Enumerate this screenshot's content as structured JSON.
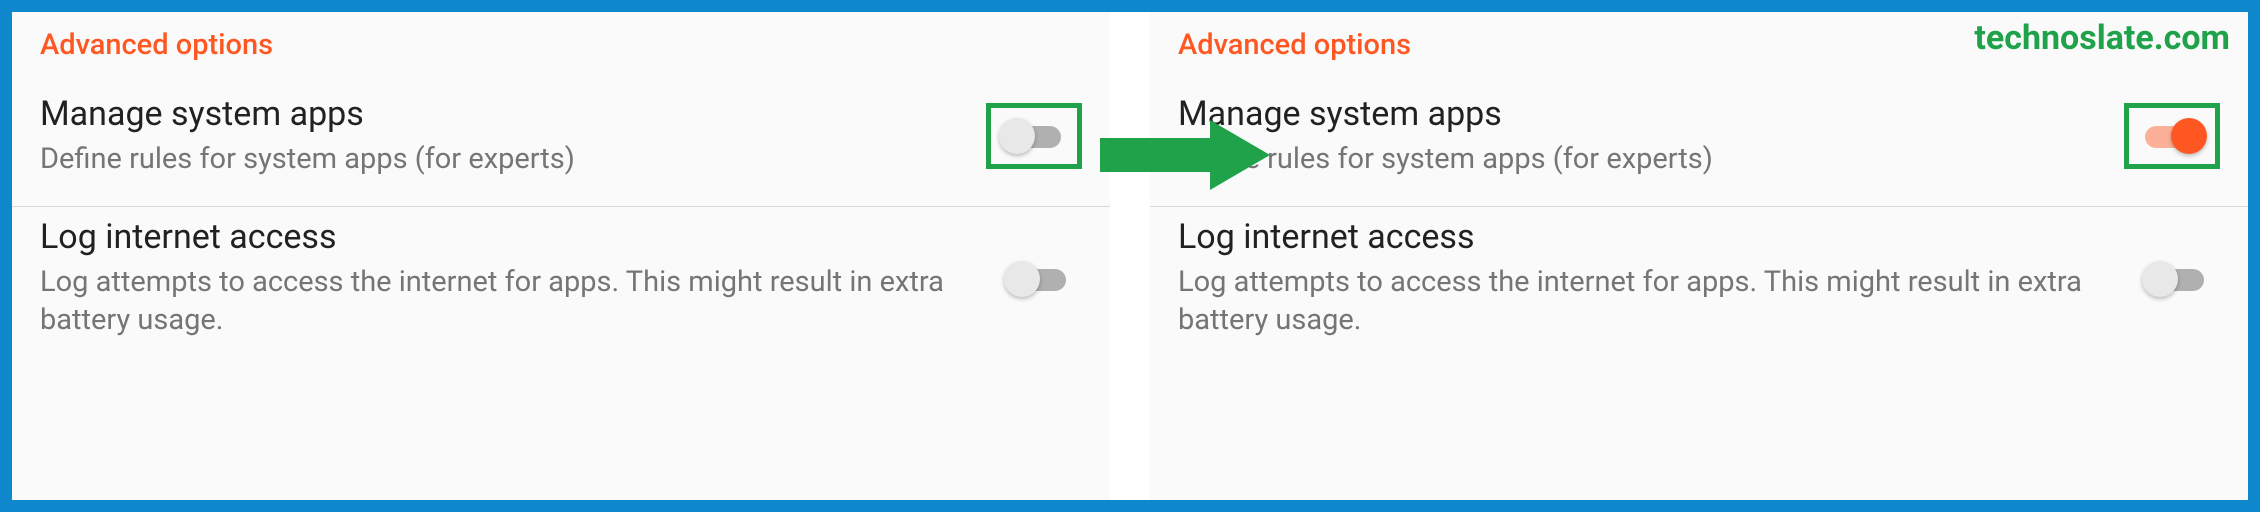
{
  "watermark": "technoslate.com",
  "panels": {
    "left": {
      "header": "Advanced options",
      "rows": [
        {
          "title": "Manage system apps",
          "subtitle": "Define rules for system apps (for experts)",
          "toggle": "off",
          "highlighted": true
        },
        {
          "title": "Log internet access",
          "subtitle": "Log attempts to access the internet for apps. This might result in extra battery usage.",
          "toggle": "off",
          "highlighted": false
        }
      ]
    },
    "right": {
      "header": "Advanced options",
      "rows": [
        {
          "title": "Manage system apps",
          "subtitle": "Define rules for system apps (for experts)",
          "toggle": "on",
          "highlighted": true
        },
        {
          "title": "Log internet access",
          "subtitle": "Log attempts to access the internet for apps. This might result in extra battery usage.",
          "toggle": "off",
          "highlighted": false
        }
      ]
    }
  },
  "colors": {
    "border": "#0e87cc",
    "accent": "#ff5722",
    "highlight": "#1fa24a",
    "arrow": "#1fa24a"
  }
}
